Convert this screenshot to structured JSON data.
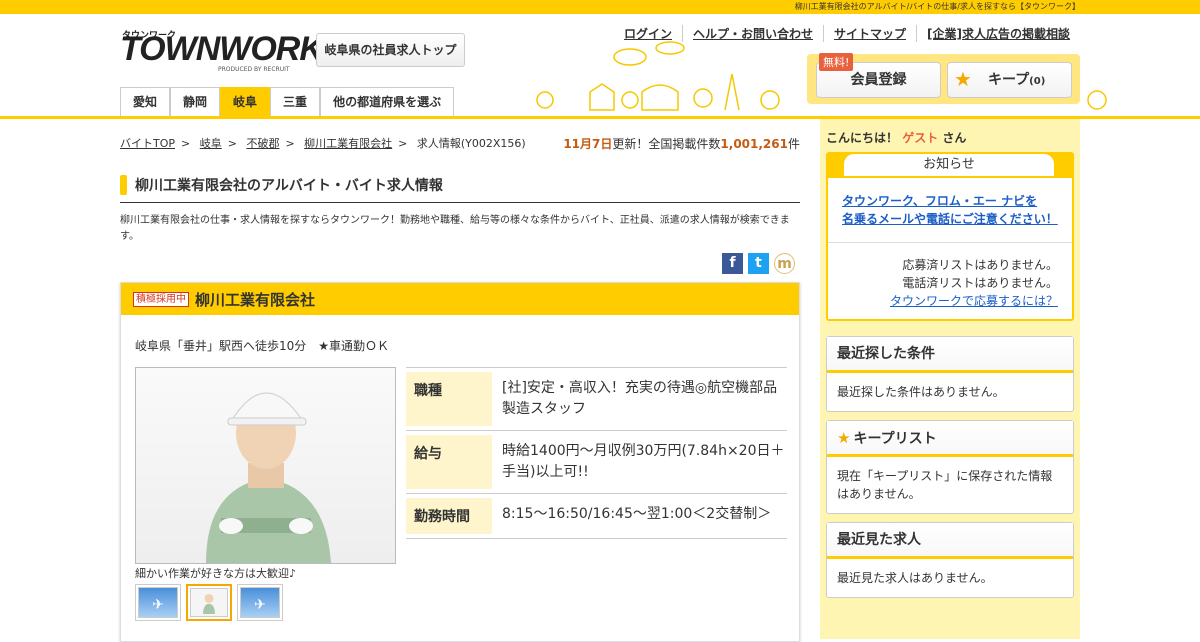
{
  "topbar": {
    "text": "柳川工業有限会社のアルバイト/バイトの仕事/求人を探すなら【タウンワーク】"
  },
  "logo": {
    "kana": "タウンワーク",
    "main": "TOWNWORK",
    "produced": "PRODUCED BY RECRUIT"
  },
  "header": {
    "gifu_top_label": "岐阜県の社員求人トップ",
    "links": [
      "ログイン",
      "ヘルプ・お問い合わせ",
      "サイトマップ",
      "[企業]求人広告の掲載相談"
    ],
    "free_badge": "無料!",
    "member_label": "会員登録",
    "keep_label": "キープ",
    "keep_count": "(0)"
  },
  "prefnav": {
    "items": [
      "愛知",
      "静岡",
      "岐阜",
      "三重",
      "他の都道府県を選ぶ"
    ],
    "active": "岐阜"
  },
  "breadcrumb": {
    "items": [
      "バイトTOP",
      "岐阜",
      "不破郡",
      "柳川工業有限会社"
    ],
    "current": "求人情報(Y002X156)"
  },
  "update": {
    "date": "11月7日",
    "mid": "更新！全国掲載件数",
    "count": "1,001,261",
    "unit": "件"
  },
  "page_title": "柳川工業有限会社のアルバイト・バイト求人情報",
  "description": "柳川工業有限会社の仕事・求人情報を探すならタウンワーク！勤務地や職種、給与等の様々な条件からバイト、正社員、派遣の求人情報が検索できます。",
  "job": {
    "badge": "積極採用中",
    "company": "柳川工業有限会社",
    "access": "岐阜県「垂井」駅西へ徒歩10分　★車通勤ＯＫ",
    "caption": "細かい作業が好きな方は大歓迎♪",
    "rows": [
      {
        "label": "職種",
        "value": "[社]安定・高収入！充実の待遇◎航空機部品製造スタッフ"
      },
      {
        "label": "給与",
        "value": "時給1400円～月収例30万円(7.84h×20日＋手当)以上可!!"
      },
      {
        "label": "勤務時間",
        "value": "8:15～16:50/16:45～翌1:00＜2交替制＞"
      }
    ]
  },
  "sidebar": {
    "greeting_pre": "こんにちは！",
    "guest": "ゲスト",
    "greeting_post": "さん",
    "notice_tab": "お知らせ",
    "notice_warn1": "タウンワーク、フロム・エー ナビを",
    "notice_warn2": "名乗るメールや電話にご注意ください！",
    "status1": "応募済リストはありません。",
    "status2": "電話済リストはありません。",
    "status_link": "タウンワークで応募するには？",
    "recent_search_title": "最近探した条件",
    "recent_search_body": "最近探した条件はありません。",
    "keep_list_title": "キープリスト",
    "keep_list_body": "現在「キープリスト」に保存された情報はありません。",
    "recent_view_title": "最近見た求人",
    "recent_view_body": "最近見た求人はありません。"
  },
  "colors": {
    "brand": "#ffcc00",
    "accent": "#c55a11",
    "link": "#1a5ec7"
  }
}
